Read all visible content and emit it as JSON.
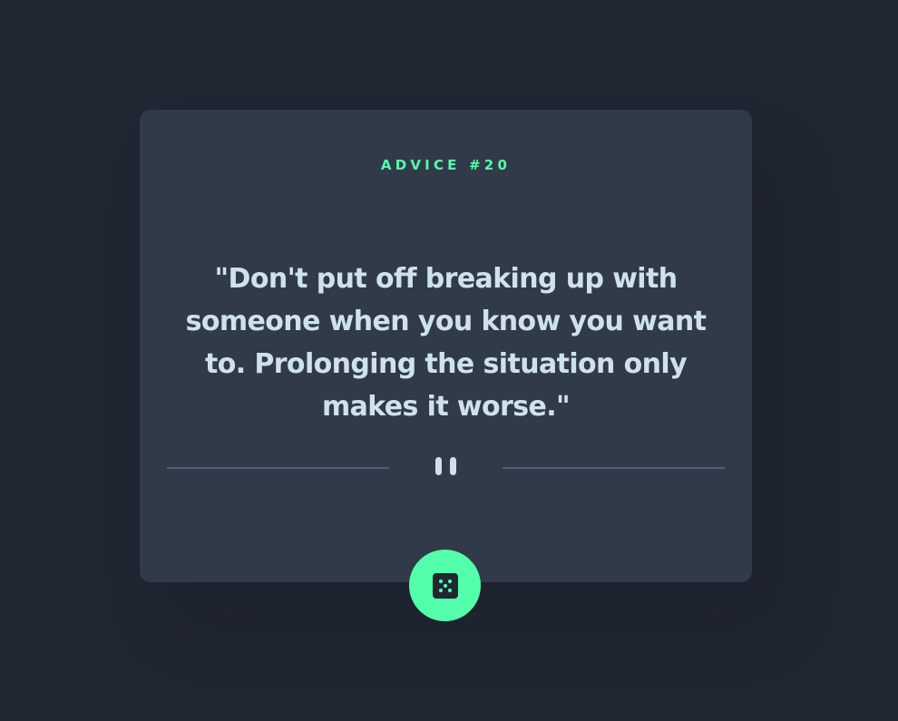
{
  "advice": {
    "id_label": "ADVICE #20",
    "quote": "\"Don't put off breaking up with someone when you know you want to. Prolonging the situation only makes it worse.\""
  },
  "icons": {
    "divider": "pause-icon",
    "generate": "dice-icon"
  },
  "colors": {
    "background": "#202632",
    "card": "#313a49",
    "accent": "#53ffaa",
    "text": "#cee3e9",
    "divider": "#4f5d74"
  }
}
